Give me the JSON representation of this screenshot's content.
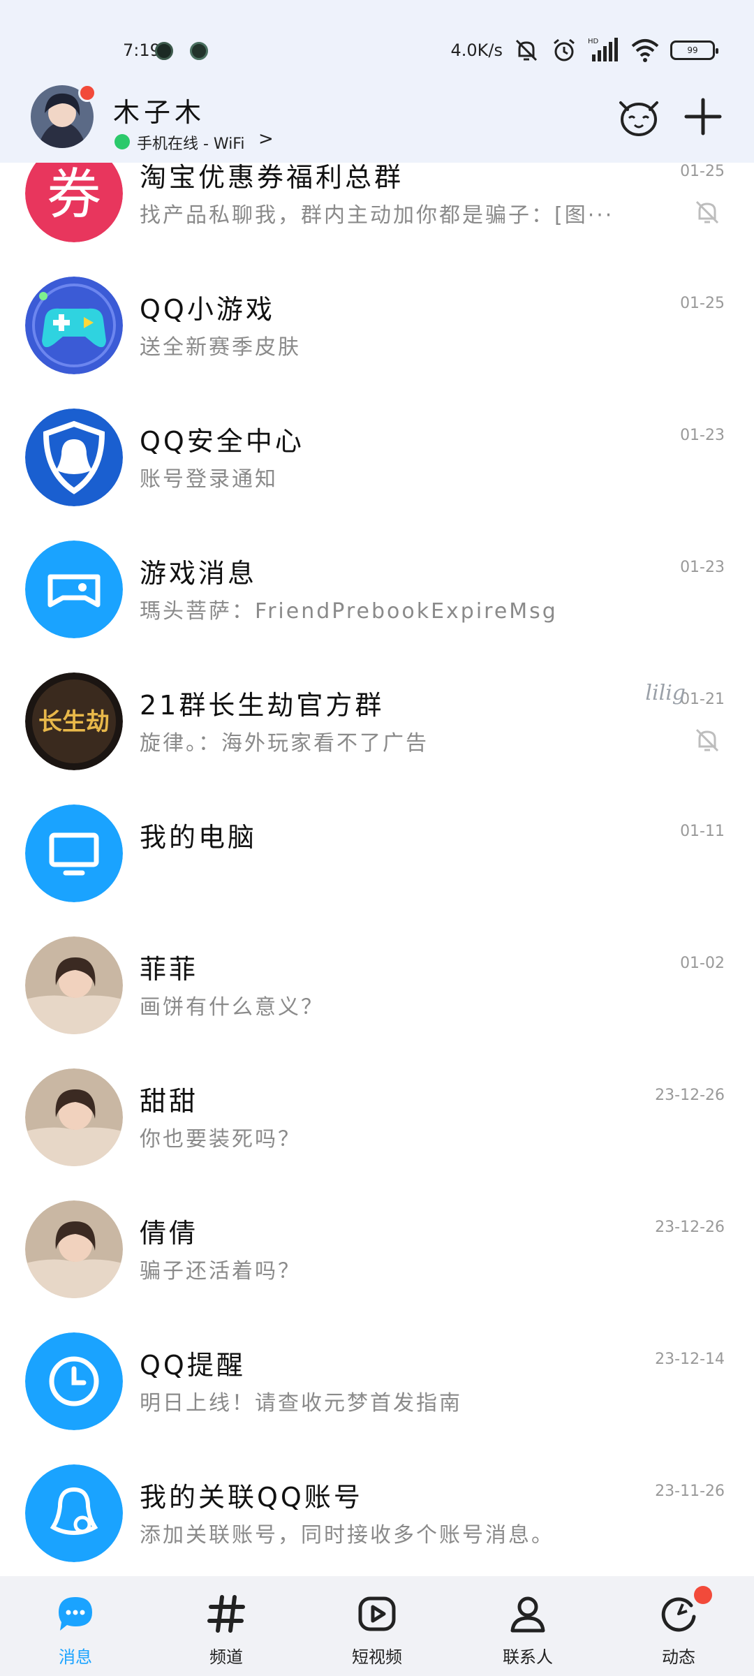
{
  "status_bar": {
    "time": "7:19",
    "net_speed": "4.0K/s",
    "battery": "99"
  },
  "profile": {
    "name": "木子木",
    "status": "手机在线 - WiFi",
    "status_chevron": ">"
  },
  "conversations": [
    {
      "title": "淘宝优惠券福利总群",
      "preview": "找产品私聊我，群内主动加你都是骗子：[图···",
      "time": "01-25",
      "avatar_icon": "coupon-icon",
      "avatar_text": "券",
      "muted": true
    },
    {
      "title": "QQ小游戏",
      "preview": "送全新赛季皮肤",
      "time": "01-25",
      "avatar_icon": "gamepad-icon",
      "muted": false
    },
    {
      "title": "QQ安全中心",
      "preview": "账号登录通知",
      "time": "01-23",
      "avatar_icon": "shield-penguin-icon",
      "muted": false
    },
    {
      "title": "游戏消息",
      "preview": "瑪头菩萨：FriendPrebookExpireMsg",
      "time": "01-23",
      "avatar_icon": "game-message-icon",
      "muted": false
    },
    {
      "title": "21群长生劫官方群",
      "preview": "旋律。：海外玩家看不了广告",
      "time": "01-21",
      "avatar_icon": "game-logo",
      "avatar_text": "长生劫",
      "tag": "lilig",
      "muted": true
    },
    {
      "title": "我的电脑",
      "preview": "",
      "time": "01-11",
      "avatar_icon": "monitor-icon",
      "muted": false
    },
    {
      "title": "菲菲",
      "preview": "画饼有什么意义？",
      "time": "01-02",
      "avatar_icon": "user-photo",
      "muted": false
    },
    {
      "title": "甜甜",
      "preview": "你也要装死吗？",
      "time": "23-12-26",
      "avatar_icon": "user-photo",
      "muted": false
    },
    {
      "title": "倩倩",
      "preview": "骗子还活着吗？",
      "time": "23-12-26",
      "avatar_icon": "user-photo",
      "muted": false
    },
    {
      "title": "QQ提醒",
      "preview": "明日上线！请查收元梦首发指南",
      "time": "23-12-14",
      "avatar_icon": "clock-icon",
      "muted": false
    },
    {
      "title": "我的关联QQ账号",
      "preview": "添加关联账号，同时接收多个账号消息。",
      "time": "23-11-26",
      "avatar_icon": "linked-account-icon",
      "muted": false
    }
  ],
  "bottom_nav": [
    {
      "label": "消息",
      "icon": "message-icon",
      "active": true
    },
    {
      "label": "频道",
      "icon": "hash-icon",
      "active": false
    },
    {
      "label": "短视频",
      "icon": "play-icon",
      "active": false
    },
    {
      "label": "联系人",
      "icon": "contact-icon",
      "active": false
    },
    {
      "label": "动态",
      "icon": "activity-icon",
      "active": false,
      "badge": true
    }
  ],
  "colors": {
    "accent": "#1aa3ff",
    "header_bg": "#eef2fb",
    "coupon_red": "#e8365d",
    "badge_red": "#f24a3a",
    "online_green": "#2bc96b",
    "preview_gray": "#8a8a8a"
  }
}
